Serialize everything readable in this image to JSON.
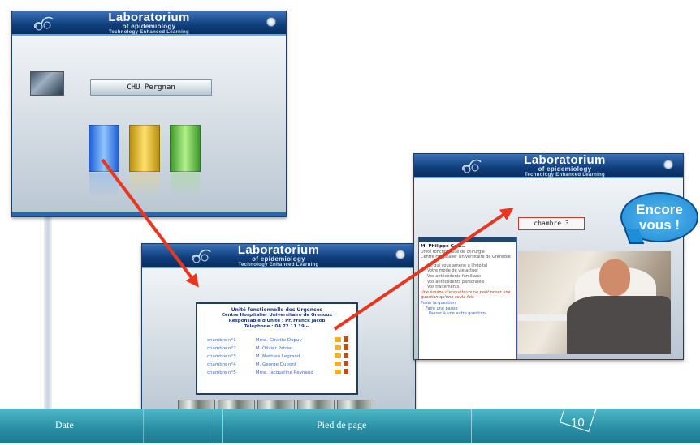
{
  "header": {
    "title": "Laboratorium",
    "subtitle": "of epidemiology",
    "tagline": "Technology Enhanced Learning"
  },
  "slide1": {
    "hospital_name": "CHU Pergnan"
  },
  "slide2": {
    "unit_lines": [
      "Unité fonctionnelle des Urgences",
      "Centre Hospitalier Universitaire de Grenoux",
      "Responsable d'Unité : Pr. Franck Jacob",
      "Téléphone : 04 72 11 19 --"
    ],
    "rooms": [
      {
        "room": "chambre n°1",
        "patient": "Mme. Ginette Dupuy"
      },
      {
        "room": "chambre n°2",
        "patient": "M. Olivier Patrier"
      },
      {
        "room": "chambre n°3",
        "patient": "M. Mathieu Legrand"
      },
      {
        "room": "chambre n°4",
        "patient": "M. George Dupont"
      },
      {
        "room": "chambre n°5",
        "patient": "Mme. Jacqueline Reynaud"
      }
    ]
  },
  "slide3": {
    "room_label": "chambre 3",
    "patient_name": "M. Philippe Gau...",
    "lines": [
      "Unité fonctionnelle de chirurgie",
      "Centre Hospitalier Universitaire de Grenoble",
      "Ce qui vous amène à l'hôpital",
      "Votre mode de vie actuel",
      "Vos antécédents familiaux",
      "Vos antécédents personnels",
      "Vos traitements"
    ],
    "red_text": "Une équipe d'enquêteurs ne peut poser une question qu'une seule fois",
    "blue_lines": [
      "Poser la question",
      "Faire une pause",
      "Passer à une autre question"
    ],
    "speech": "Encore vous !"
  },
  "footer": {
    "date": "Date",
    "footer_text": "Pied de page",
    "page_number": "10"
  },
  "colors": {
    "header_blue": "#0f3e7c",
    "arrow_red": "#e8361f",
    "footer_teal": "#2990a6"
  }
}
